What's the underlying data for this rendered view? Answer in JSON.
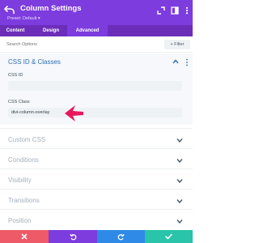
{
  "header": {
    "title": "Column Settings",
    "preset": "Preset: Default",
    "back_icon": "undo-arrow-icon",
    "icons": [
      "expand-icon",
      "sidebar-icon",
      "more-vertical-icon"
    ],
    "colors": {
      "header_bg": "#7d3cde",
      "tabs_bg": "#6c2eb9",
      "link_blue": "#2c6fb8"
    }
  },
  "tabs": [
    {
      "label": "Content",
      "active": false
    },
    {
      "label": "Design",
      "active": false
    },
    {
      "label": "Advanced",
      "active": true
    }
  ],
  "search": {
    "placeholder": "Search Options",
    "filter_label": "+ Filter"
  },
  "open_section": {
    "title": "CSS ID & Classes",
    "fields": [
      {
        "label": "CSS ID",
        "value": ""
      },
      {
        "label": "CSS Class",
        "value": "divi-column-overlay"
      }
    ]
  },
  "closed_sections": [
    {
      "title": "Custom CSS"
    },
    {
      "title": "Conditions"
    },
    {
      "title": "Visibility"
    },
    {
      "title": "Transitions"
    },
    {
      "title": "Position"
    }
  ],
  "footer": {
    "buttons": [
      {
        "name": "discard",
        "icon": "close-icon",
        "color": "#ee5a67"
      },
      {
        "name": "undo",
        "icon": "undo-icon",
        "color": "#7d3cde"
      },
      {
        "name": "redo",
        "icon": "redo-icon",
        "color": "#2e8ae6"
      },
      {
        "name": "save",
        "icon": "checkmark-icon",
        "color": "#29c4a9"
      }
    ]
  }
}
